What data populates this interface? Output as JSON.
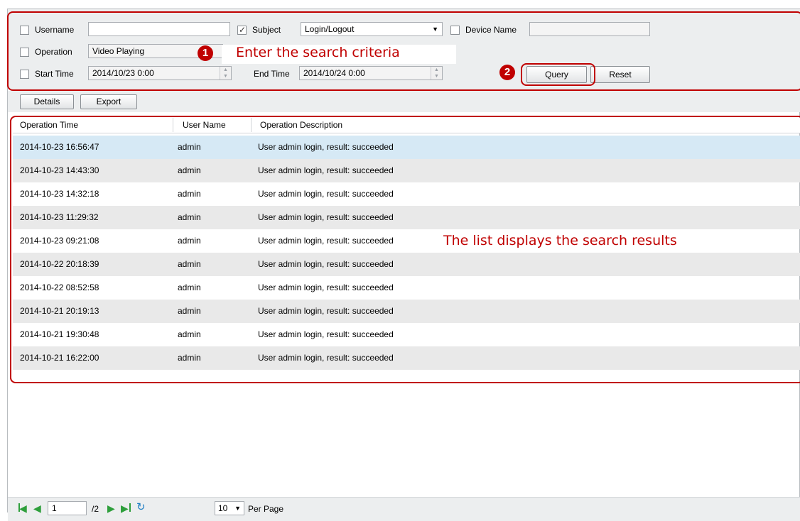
{
  "criteria": {
    "username_label": "Username",
    "username_value": "",
    "subject_label": "Subject",
    "subject_value": "Login/Logout",
    "device_label": "Device Name",
    "device_value": "",
    "operation_label": "Operation",
    "operation_value": "Video Playing",
    "start_label": "Start Time",
    "start_value": "2014/10/23 0:00",
    "end_label": "End Time",
    "end_value": "2014/10/24 0:00",
    "query_label": "Query",
    "reset_label": "Reset"
  },
  "toolbar": {
    "details_label": "Details",
    "export_label": "Export"
  },
  "table": {
    "columns": [
      "Operation Time",
      "User Name",
      "Operation Description"
    ],
    "rows": [
      [
        "2014-10-23 16:56:47",
        "admin",
        "User admin login, result: succeeded"
      ],
      [
        "2014-10-23 14:43:30",
        "admin",
        "User admin login, result: succeeded"
      ],
      [
        "2014-10-23 14:32:18",
        "admin",
        "User admin login, result: succeeded"
      ],
      [
        "2014-10-23 11:29:32",
        "admin",
        "User admin login, result: succeeded"
      ],
      [
        "2014-10-23 09:21:08",
        "admin",
        "User admin login, result: succeeded"
      ],
      [
        "2014-10-22 20:18:39",
        "admin",
        "User admin login, result: succeeded"
      ],
      [
        "2014-10-22 08:52:58",
        "admin",
        "User admin login, result: succeeded"
      ],
      [
        "2014-10-21 20:19:13",
        "admin",
        "User admin login, result: succeeded"
      ],
      [
        "2014-10-21 19:30:48",
        "admin",
        "User admin login, result: succeeded"
      ],
      [
        "2014-10-21 16:22:00",
        "admin",
        "User admin login, result: succeeded"
      ]
    ]
  },
  "pagination": {
    "current_page": "1",
    "total_pages": "/2",
    "per_page_value": "10",
    "per_page_label": "Per Page"
  },
  "annotations": {
    "step1_number": "1",
    "step1_text": "Enter the search criteria",
    "step2_number": "2",
    "list_text": "The list displays the search results"
  },
  "icons": {
    "first_page": "first-page-icon",
    "prev_page": "prev-page-icon",
    "next_page": "next-page-icon",
    "last_page": "last-page-icon",
    "refresh": "refresh-icon"
  },
  "colors": {
    "annotation": "#c00000",
    "selected_row": "#d6e9f5",
    "alt_row": "#e9e9e9",
    "panel_bg": "#eceeef",
    "nav_icon": "#2e9f3c"
  }
}
